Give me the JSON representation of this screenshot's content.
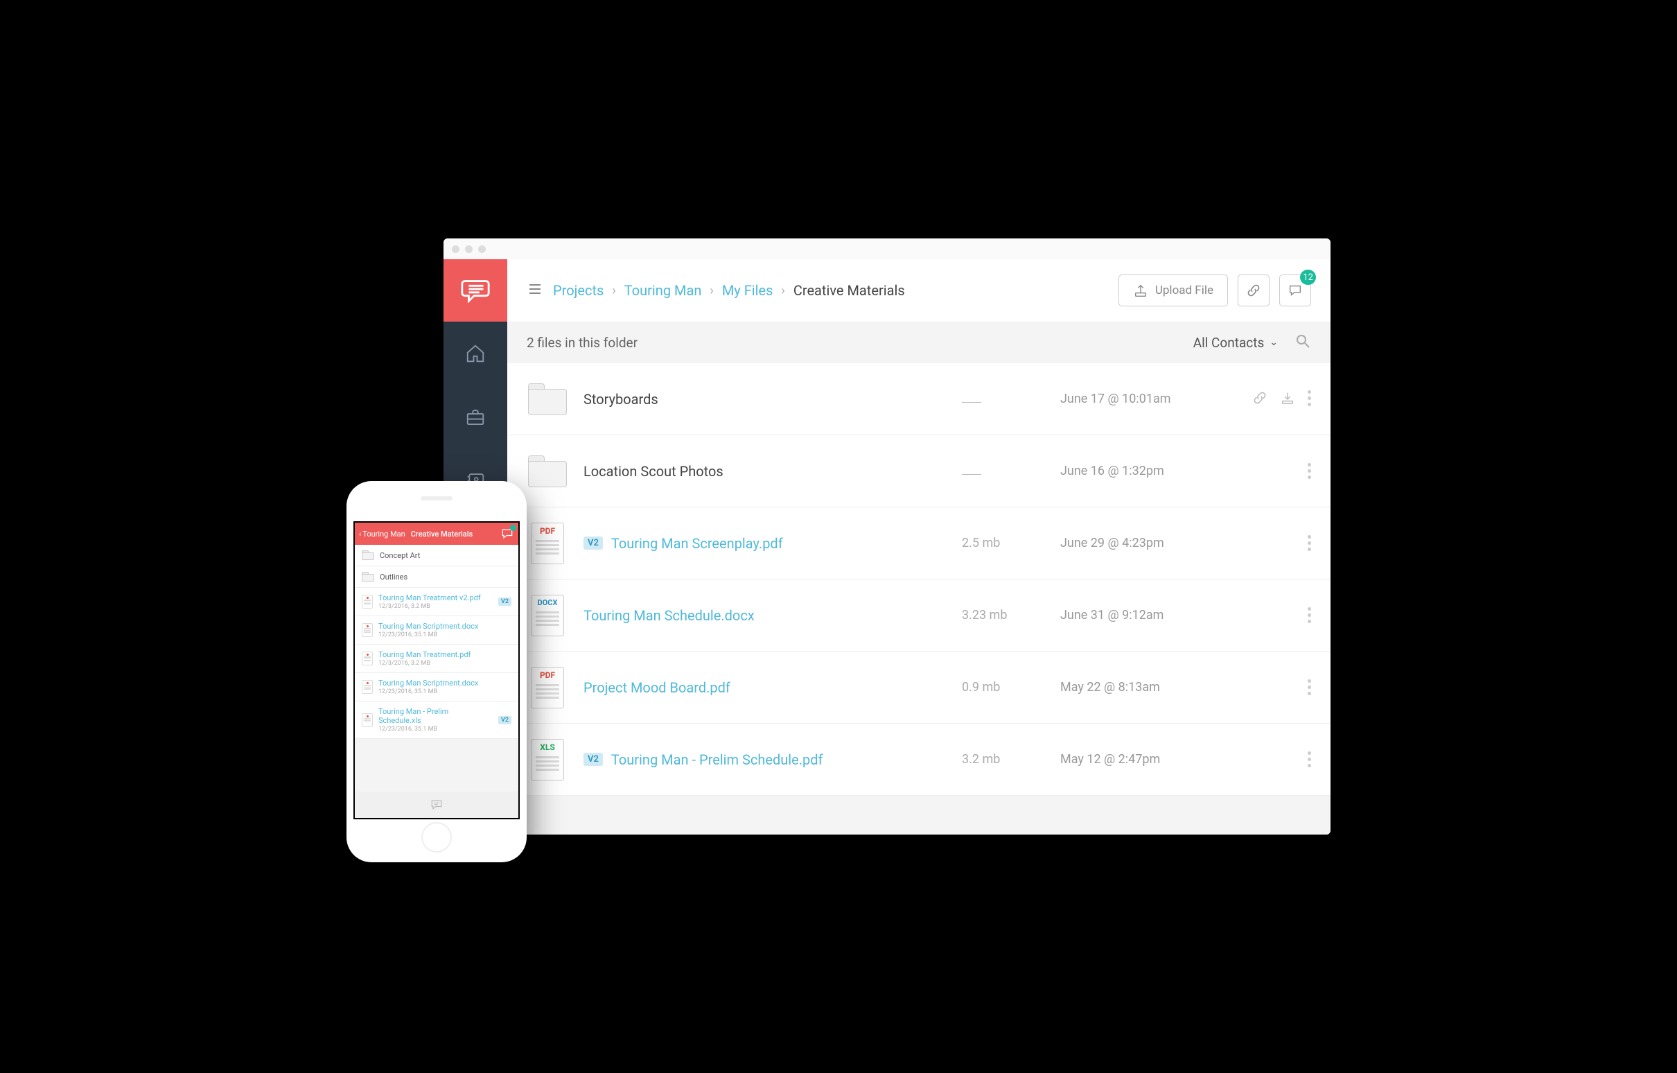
{
  "breadcrumbs": {
    "items": [
      "Projects",
      "Touring Man",
      "My Files"
    ],
    "current": "Creative Materials"
  },
  "topbar": {
    "upload_label": "Upload File",
    "comments_badge": "12"
  },
  "subheader": {
    "count_text": "2 files in this folder",
    "contacts_label": "All Contacts"
  },
  "files": [
    {
      "type": "folder",
      "name": "Storyboards",
      "size": "",
      "date": "June 17 @ 10:01am",
      "version": "",
      "show_actions": true
    },
    {
      "type": "folder",
      "name": "Location Scout Photos",
      "size": "",
      "date": "June 16 @ 1:32pm",
      "version": "",
      "show_actions": false
    },
    {
      "type": "pdf",
      "name": "Touring Man Screenplay.pdf",
      "size": "2.5 mb",
      "date": "June 29 @ 4:23pm",
      "version": "V2",
      "show_actions": false
    },
    {
      "type": "docx",
      "name": "Touring Man Schedule.docx",
      "size": "3.23 mb",
      "date": "June 31 @ 9:12am",
      "version": "",
      "show_actions": false
    },
    {
      "type": "pdf",
      "name": "Project Mood Board.pdf",
      "size": "0.9 mb",
      "date": "May 22 @ 8:13am",
      "version": "",
      "show_actions": false
    },
    {
      "type": "xls",
      "name": "Touring Man - Prelim Schedule.pdf",
      "size": "3.2 mb",
      "date": "May 12 @ 2:47pm",
      "version": "V2",
      "show_actions": false
    }
  ],
  "phone": {
    "back_label": "Touring Man",
    "title": "Creative Materials",
    "items": [
      {
        "type": "folder",
        "name": "Concept Art",
        "sub": "",
        "version": ""
      },
      {
        "type": "folder",
        "name": "Outlines",
        "sub": "",
        "version": ""
      },
      {
        "type": "file",
        "name": "Touring Man Treatment v2.pdf",
        "sub": "12/3/2016, 3.2 MB",
        "version": "V2"
      },
      {
        "type": "file",
        "name": "Touring Man Scriptment.docx",
        "sub": "12/23/2016, 35.1 MB",
        "version": ""
      },
      {
        "type": "file",
        "name": "Touring Man Treatment.pdf",
        "sub": "12/3/2016, 3.2 MB",
        "version": ""
      },
      {
        "type": "file",
        "name": "Touring Man Scriptment.docx",
        "sub": "12/23/2016, 35.1 MB",
        "version": ""
      },
      {
        "type": "file",
        "name": "Touring Man - Prelim Schedule.xls",
        "sub": "12/23/2016, 35.1 MB",
        "version": "V2"
      }
    ]
  }
}
